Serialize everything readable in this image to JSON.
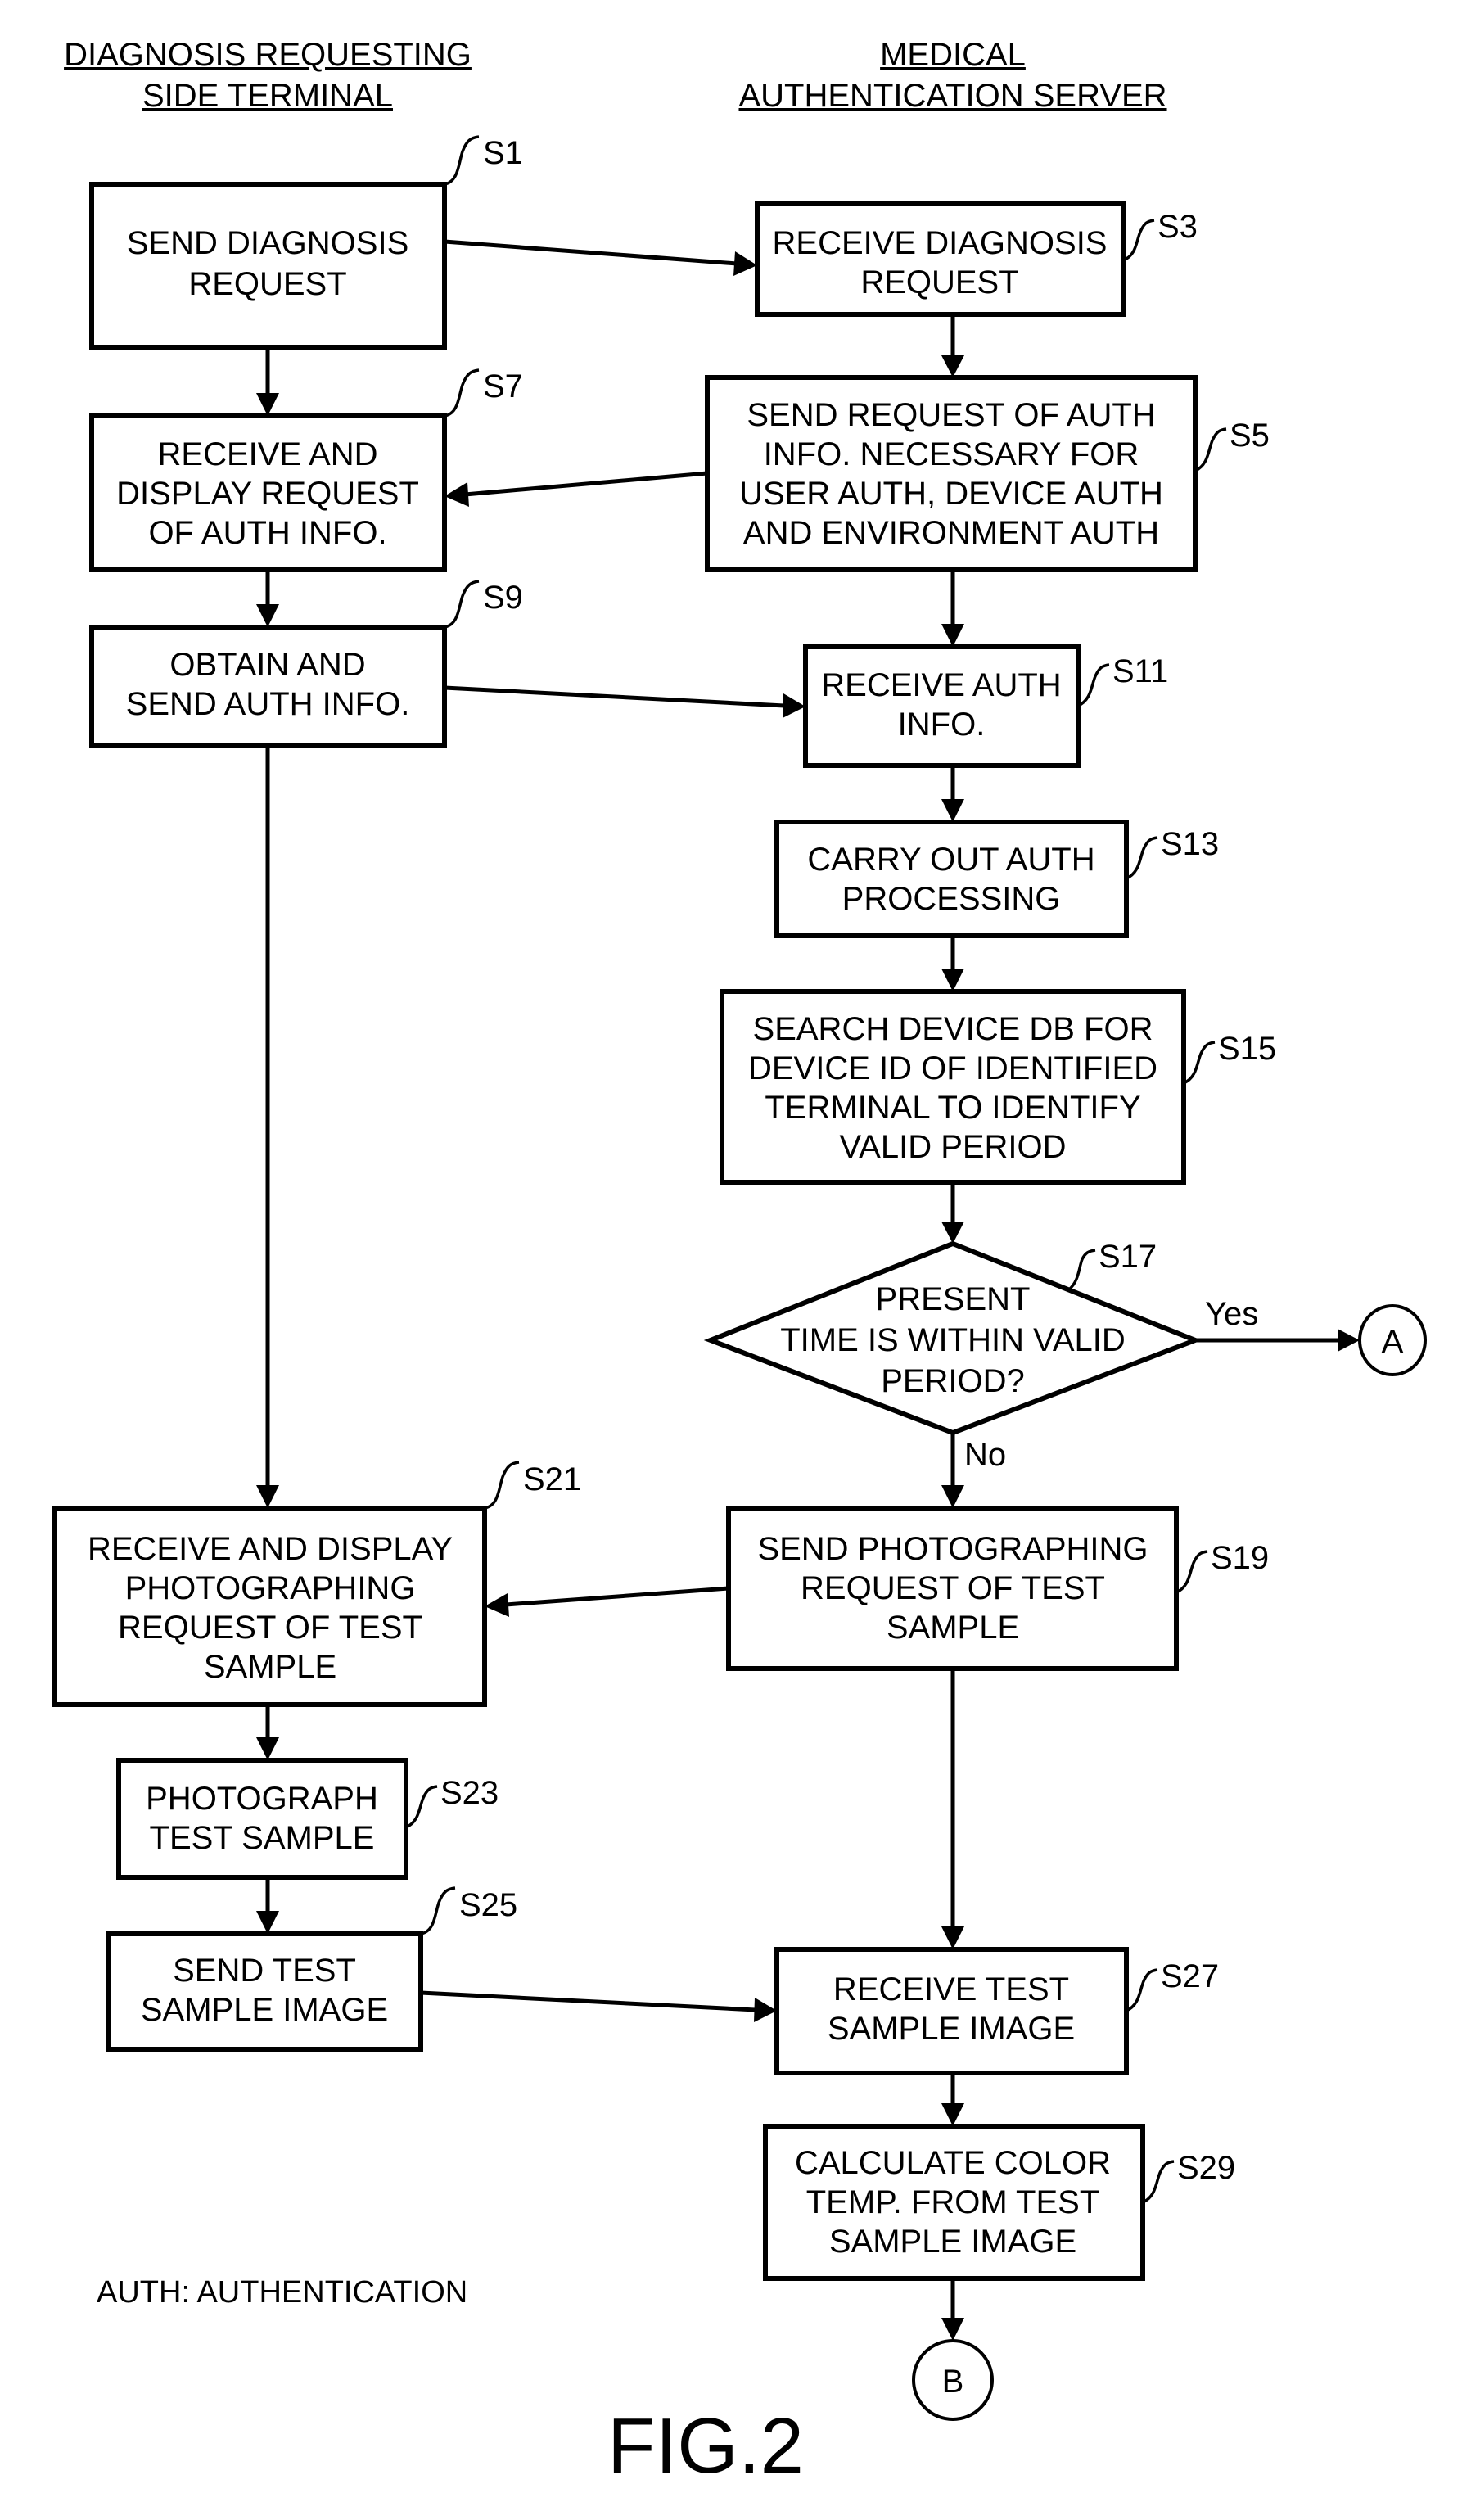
{
  "headers": {
    "left": [
      "DIAGNOSIS REQUESTING",
      "SIDE TERMINAL"
    ],
    "right": [
      "MEDICAL",
      "AUTHENTICATION SERVER"
    ]
  },
  "steps": {
    "S1": {
      "label": "S1",
      "lines": [
        "SEND DIAGNOSIS",
        "REQUEST"
      ]
    },
    "S3": {
      "label": "S3",
      "lines": [
        "RECEIVE DIAGNOSIS",
        "REQUEST"
      ]
    },
    "S5": {
      "label": "S5",
      "lines": [
        "SEND REQUEST OF AUTH",
        "INFO. NECESSARY FOR",
        "USER AUTH, DEVICE AUTH",
        "AND ENVIRONMENT AUTH"
      ]
    },
    "S7": {
      "label": "S7",
      "lines": [
        "RECEIVE AND",
        "DISPLAY REQUEST",
        "OF AUTH INFO."
      ]
    },
    "S9": {
      "label": "S9",
      "lines": [
        "OBTAIN AND",
        "SEND AUTH INFO."
      ]
    },
    "S11": {
      "label": "S11",
      "lines": [
        "RECEIVE AUTH",
        "INFO."
      ]
    },
    "S13": {
      "label": "S13",
      "lines": [
        "CARRY OUT AUTH",
        "PROCESSING"
      ]
    },
    "S15": {
      "label": "S15",
      "lines": [
        "SEARCH DEVICE DB FOR",
        "DEVICE ID OF IDENTIFIED",
        "TERMINAL TO IDENTIFY",
        "VALID PERIOD"
      ]
    },
    "S17": {
      "label": "S17",
      "lines": [
        "PRESENT",
        "TIME IS WITHIN VALID",
        "PERIOD?"
      ],
      "yes": "Yes",
      "no": "No"
    },
    "S19": {
      "label": "S19",
      "lines": [
        "SEND PHOTOGRAPHING",
        "REQUEST OF TEST",
        "SAMPLE"
      ]
    },
    "S21": {
      "label": "S21",
      "lines": [
        "RECEIVE AND DISPLAY",
        "PHOTOGRAPHING",
        "REQUEST OF TEST",
        "SAMPLE"
      ]
    },
    "S23": {
      "label": "S23",
      "lines": [
        "PHOTOGRAPH",
        "TEST SAMPLE"
      ]
    },
    "S25": {
      "label": "S25",
      "lines": [
        "SEND TEST",
        "SAMPLE IMAGE"
      ]
    },
    "S27": {
      "label": "S27",
      "lines": [
        "RECEIVE TEST",
        "SAMPLE IMAGE"
      ]
    },
    "S29": {
      "label": "S29",
      "lines": [
        "CALCULATE COLOR",
        "TEMP. FROM TEST",
        "SAMPLE IMAGE"
      ]
    }
  },
  "connectors": {
    "A": "A",
    "B": "B"
  },
  "note": "AUTH: AUTHENTICATION",
  "figure_label": "FIG.2"
}
